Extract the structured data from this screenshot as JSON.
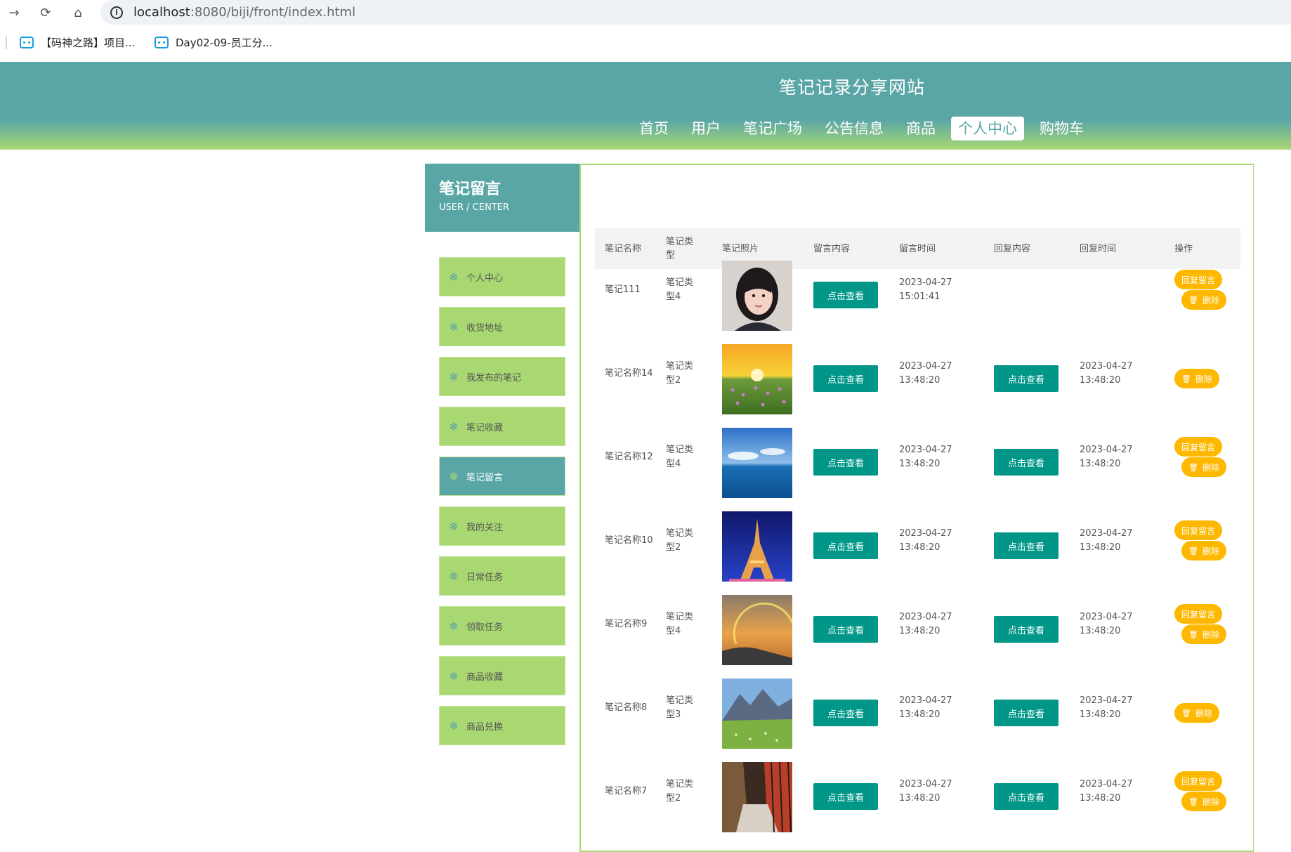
{
  "browser": {
    "url_host": "localhost",
    "url_path": ":8080/biji/front/index.html",
    "bookmarks": [
      "【码神之路】项目...",
      "Day02-09-员工分..."
    ]
  },
  "site": {
    "title": "笔记记录分享网站",
    "nav": [
      "首页",
      "用户",
      "笔记广场",
      "公告信息",
      "商品",
      "个人中心",
      "购物车"
    ],
    "nav_active": "个人中心"
  },
  "sidebar": {
    "title": "笔记留言",
    "subtitle": "USER / CENTER",
    "items": [
      "个人中心",
      "收货地址",
      "我发布的笔记",
      "笔记收藏",
      "笔记留言",
      "我的关注",
      "日常任务",
      "领取任务",
      "商品收藏",
      "商品兑换"
    ],
    "active": "笔记留言"
  },
  "table": {
    "headers": [
      "笔记名称",
      "笔记类型",
      "笔记照片",
      "留言内容",
      "留言时间",
      "回复内容",
      "回复时间",
      "操作"
    ],
    "view_label": "点击查看",
    "reply_label": "回复留言",
    "delete_label": "删除",
    "rows": [
      {
        "name": "笔记111",
        "type": "笔记类型4",
        "photo": "portrait",
        "msg_time": "2023-04-27 15:01:41",
        "has_reply": false,
        "reply_time": "",
        "can_reply": true
      },
      {
        "name": "笔记名称14",
        "type": "笔记类型2",
        "photo": "sunset-field",
        "msg_time": "2023-04-27 13:48:20",
        "has_reply": true,
        "reply_time": "2023-04-27 13:48:20",
        "can_reply": false
      },
      {
        "name": "笔记名称12",
        "type": "笔记类型4",
        "photo": "sea-sky",
        "msg_time": "2023-04-27 13:48:20",
        "has_reply": true,
        "reply_time": "2023-04-27 13:48:20",
        "can_reply": true
      },
      {
        "name": "笔记名称10",
        "type": "笔记类型2",
        "photo": "eiffel-tower",
        "msg_time": "2023-04-27 13:48:20",
        "has_reply": true,
        "reply_time": "2023-04-27 13:48:20",
        "can_reply": true
      },
      {
        "name": "笔记名称9",
        "type": "笔记类型4",
        "photo": "rainbow-coast",
        "msg_time": "2023-04-27 13:48:20",
        "has_reply": true,
        "reply_time": "2023-04-27 13:48:20",
        "can_reply": true
      },
      {
        "name": "笔记名称8",
        "type": "笔记类型3",
        "photo": "mountain-meadow",
        "msg_time": "2023-04-27 13:48:20",
        "has_reply": true,
        "reply_time": "2023-04-27 13:48:20",
        "can_reply": false
      },
      {
        "name": "笔记名称7",
        "type": "笔记类型2",
        "photo": "corridor",
        "msg_time": "2023-04-27 13:48:20",
        "has_reply": true,
        "reply_time": "2023-04-27 13:48:20",
        "can_reply": true
      }
    ]
  },
  "colors": {
    "teal": "#5aa6a6",
    "green": "#a9d872",
    "button_teal": "#009688",
    "button_yellow": "#ffb800"
  }
}
